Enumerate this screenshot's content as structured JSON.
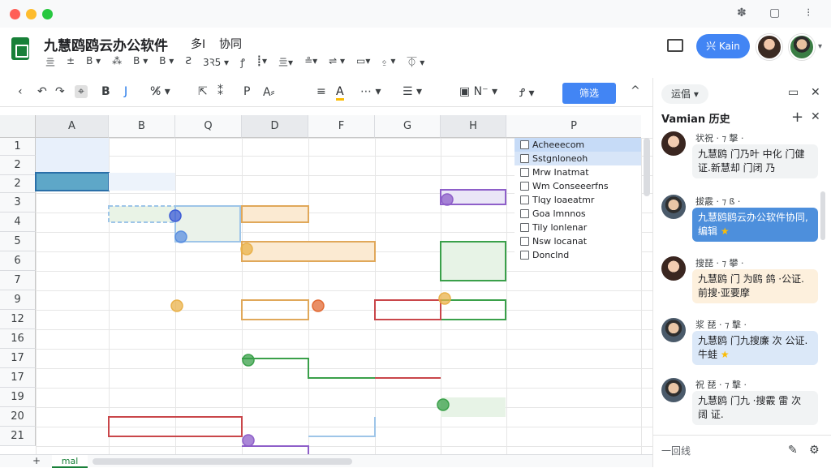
{
  "app": {
    "title": "九慧鸥鸥云办公软件",
    "sub_a": "多I",
    "sub_b": "协同",
    "share_label": "兴 Kain",
    "menu": [
      "亖",
      "±",
      "B ▾",
      "⁂",
      "B ▾",
      "B ▾",
      "Ƨ",
      "3Ꝛ5 ▾",
      "ꝭ",
      "┋▾",
      "亖▾",
      "≗▾",
      "⇌ ▾",
      "▭▾",
      "⍚ ▾",
      "⏁ ▾"
    ]
  },
  "toolbar": {
    "filter_label": "筛选",
    "collapse": "^"
  },
  "grid": {
    "columns": [
      "A",
      "B",
      "Q",
      "D",
      "F",
      "G",
      "H",
      "P"
    ],
    "rows": [
      "1",
      "2",
      "2",
      "3",
      "4",
      "5",
      "6",
      "7",
      "9",
      "12",
      "16",
      "17",
      "17",
      "19",
      "20",
      "21"
    ]
  },
  "checklist": [
    "Acheeecom",
    "Sstgnloneoh",
    "Mrw Inatmat",
    "Wm Conseeerfns",
    "Tlqy loaeatmr",
    "Goa lmnnos",
    "Tily lonlenar",
    "Nsw locanat",
    "Donclnd"
  ],
  "sheet": {
    "add": "+",
    "tab": "mal"
  },
  "panel": {
    "filter_label": "运倡 ▾",
    "title": "Vamian 历史",
    "reply_placeholder": "一回线",
    "comments": [
      {
        "name": "状祝 · ⁊ 擊 ·",
        "text": "九慧鸥 门乃叶 中化 门健证.新慧却 门闭 乃",
        "style": "gray",
        "avatar": "f",
        "star": false
      },
      {
        "name": "拔霰 · ⁊ ß ·",
        "text": "九慧鸥鸥云办公软件协同,编辑",
        "style": "blue",
        "avatar": "m",
        "star": true
      },
      {
        "name": "搜琵 · ⁊ 攀 ·",
        "text": "九慧鸥 门 为鸥 鸽 ·公证.前搜·亚要摩",
        "style": "peach",
        "avatar": "f",
        "star": false
      },
      {
        "name": "浆 琵 · ⁊ 擊 ·",
        "text": "九慧鸥 门九搜廉 次 公证.牛蛙",
        "style": "lblue",
        "avatar": "m",
        "star": true
      },
      {
        "name": "祝 琵 · ⁊ 擊 ·",
        "text": "九慧鸥 门九 ·搜霰 雷 次 阔 证.",
        "style": "gray",
        "avatar": "m",
        "star": false
      }
    ]
  }
}
